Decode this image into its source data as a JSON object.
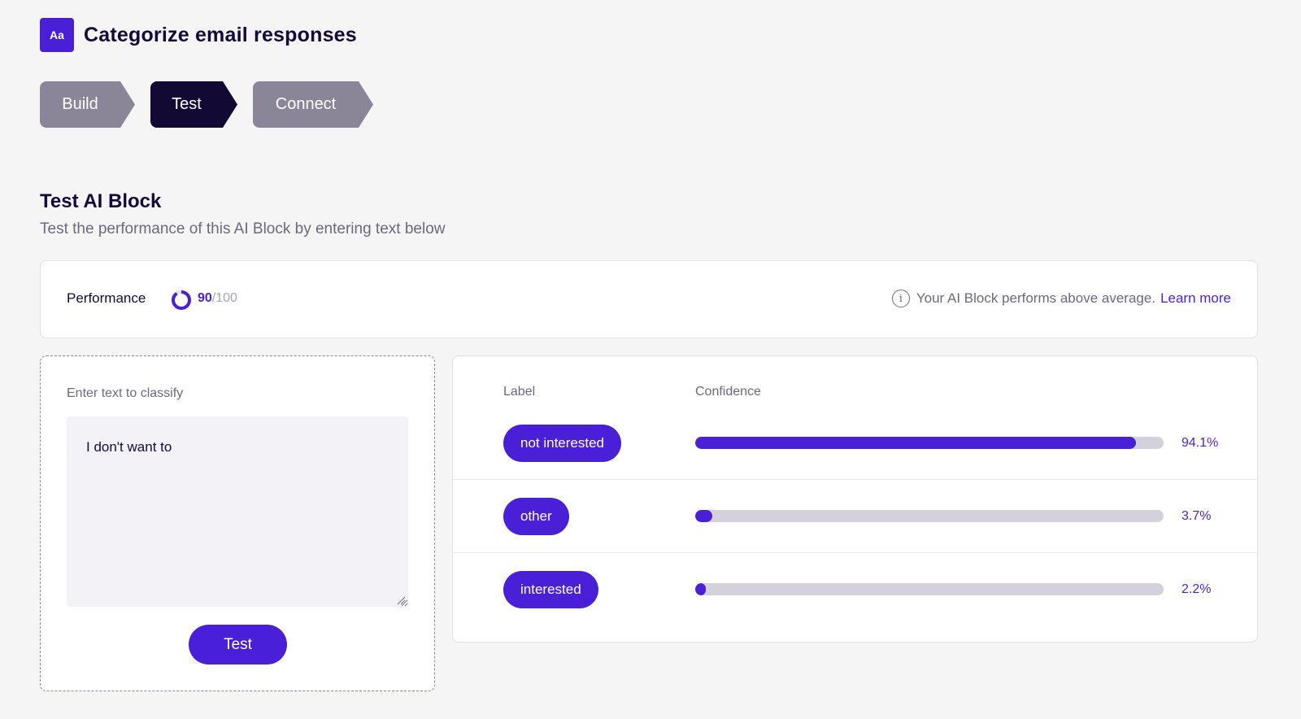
{
  "header": {
    "icon_text": "Aa",
    "title": "Categorize email responses"
  },
  "steps": [
    {
      "label": "Build",
      "active": false
    },
    {
      "label": "Test",
      "active": true
    },
    {
      "label": "Connect",
      "active": false
    }
  ],
  "section": {
    "title": "Test AI Block",
    "subtitle": "Test the performance of this AI Block by entering text below"
  },
  "performance": {
    "label": "Performance",
    "score": "90",
    "max": "/100",
    "score_fraction": 0.9,
    "info_text": "Your AI Block performs above average.",
    "learn_more": "Learn more"
  },
  "input": {
    "label": "Enter text to classify",
    "value": "I don't want to",
    "button_label": "Test"
  },
  "results": {
    "label_header": "Label",
    "confidence_header": "Confidence",
    "rows": [
      {
        "label": "not interested",
        "percent_text": "94.1%",
        "fraction": 0.941
      },
      {
        "label": "other",
        "percent_text": "3.7%",
        "fraction": 0.037
      },
      {
        "label": "interested",
        "percent_text": "2.2%",
        "fraction": 0.022
      }
    ]
  },
  "colors": {
    "accent": "#4a1fd8",
    "dark": "#120a35",
    "step_inactive": "#8a8597"
  }
}
